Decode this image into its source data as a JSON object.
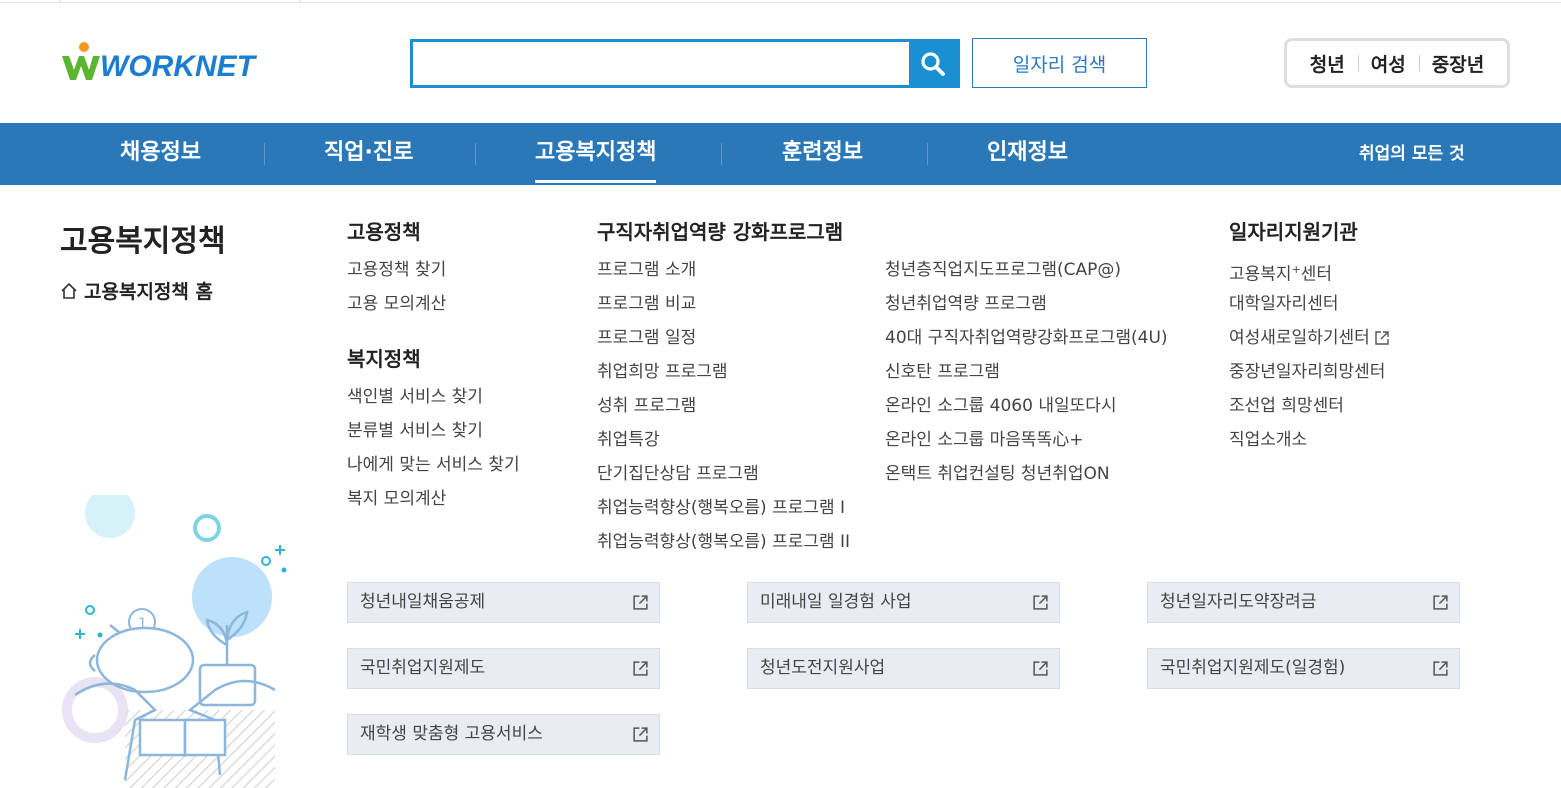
{
  "header": {
    "logo_text": "WORKNET",
    "search": {
      "placeholder": "",
      "value": ""
    },
    "job_search_label": "일자리 검색",
    "user_groups": [
      "청년",
      "여성",
      "중장년"
    ]
  },
  "gnb": {
    "items": [
      "채용정보",
      "직업·진로",
      "고용복지정책",
      "훈련정보",
      "인재정보"
    ],
    "active": "고용복지정책",
    "right_label": "취업의 모든 것"
  },
  "side": {
    "title": "고용복지정책",
    "home_label": "고용복지정책 홈"
  },
  "menu": {
    "employment_policy": {
      "title": "고용정책",
      "links": [
        "고용정책 찾기",
        "고용 모의계산"
      ]
    },
    "welfare_policy": {
      "title": "복지정책",
      "links": [
        "색인별 서비스 찾기",
        "분류별 서비스 찾기",
        "나에게 맞는 서비스 찾기",
        "복지 모의계산"
      ]
    },
    "jobseeker_program": {
      "title": "구직자취업역량 강화프로그램",
      "links_col1": [
        "프로그램 소개",
        "프로그램 비교",
        "프로그램 일정",
        "취업희망 프로그램",
        "성취 프로그램",
        "취업특강",
        "단기집단상담 프로그램",
        "취업능력향상(행복오름) 프로그램 I",
        "취업능력향상(행복오름) 프로그램 II"
      ],
      "links_col2": [
        "청년층직업지도프로그램(CAP@)",
        "청년취업역량 프로그램",
        "40대 구직자취업역량강화프로그램(4U)",
        "신호탄 프로그램",
        "온라인 소그룹 4060 내일또다시",
        "온라인 소그룹 마음똑똑心+",
        "온택트 취업컨설팅 청년취업ON"
      ]
    },
    "job_support_agencies": {
      "title": "일자리지원기관",
      "links": [
        "고용복지",
        "+",
        "센터",
        "대학일자리센터",
        "여성새로일하기센터",
        "중장년일자리희망센터",
        "조선업 희망센터",
        "직업소개소"
      ]
    }
  },
  "boxes": [
    "청년내일채움공제",
    "미래내일 일경험 사업",
    "청년일자리도약장려금",
    "국민취업지원제도",
    "청년도전지원사업",
    "국민취업지원제도(일경험)",
    "재학생 맞춤형 고용서비스"
  ],
  "icons": [
    "search-icon",
    "home-icon",
    "external-link-icon"
  ],
  "colors": {
    "brand_blue": "#2b78b9",
    "search_blue": "#1a8fd1",
    "box_bg": "#e9edf3"
  }
}
